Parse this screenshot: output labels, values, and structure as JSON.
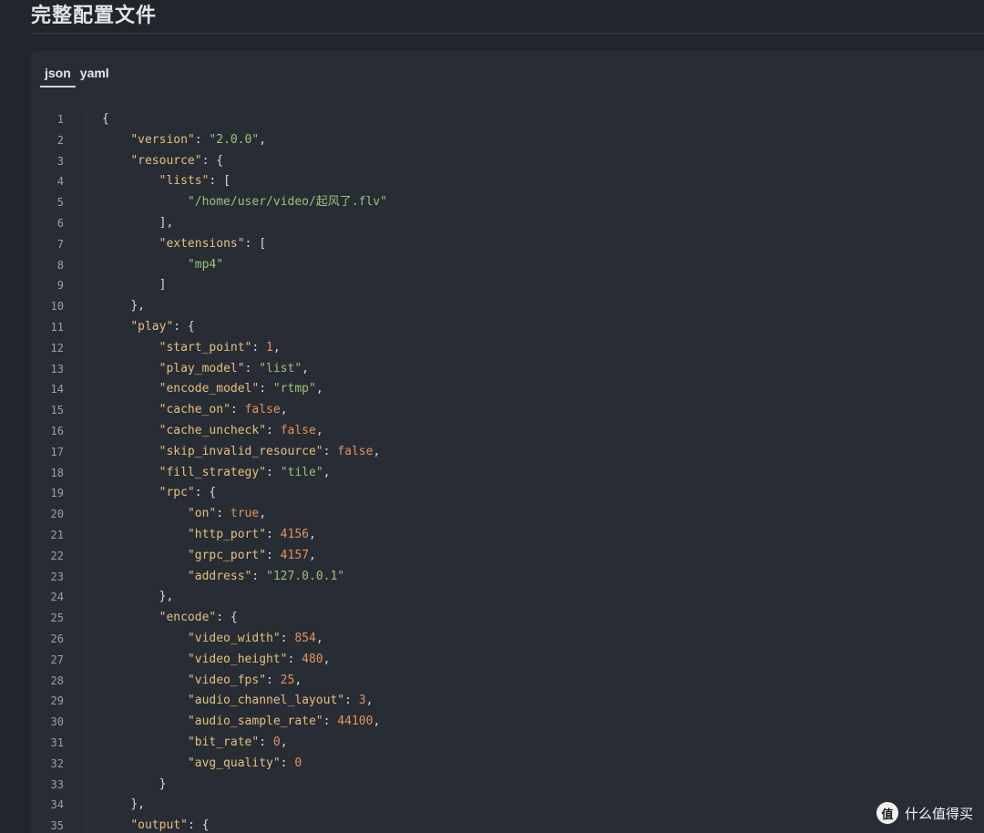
{
  "page": {
    "title": "完整配置文件"
  },
  "tabs": [
    {
      "label": "json",
      "active": true
    },
    {
      "label": "yaml",
      "active": false
    }
  ],
  "code": {
    "language": "json",
    "lines": [
      [
        {
          "t": "p",
          "v": "{"
        }
      ],
      [
        {
          "t": "i",
          "v": "    "
        },
        {
          "t": "k",
          "v": "\"version\""
        },
        {
          "t": "p",
          "v": ": "
        },
        {
          "t": "s",
          "v": "\"2.0.0\""
        },
        {
          "t": "p",
          "v": ","
        }
      ],
      [
        {
          "t": "i",
          "v": "    "
        },
        {
          "t": "k",
          "v": "\"resource\""
        },
        {
          "t": "p",
          "v": ": {"
        }
      ],
      [
        {
          "t": "i",
          "v": "        "
        },
        {
          "t": "k",
          "v": "\"lists\""
        },
        {
          "t": "p",
          "v": ": ["
        }
      ],
      [
        {
          "t": "i",
          "v": "            "
        },
        {
          "t": "s",
          "v": "\"/home/user/video/起风了.flv\""
        }
      ],
      [
        {
          "t": "i",
          "v": "        "
        },
        {
          "t": "p",
          "v": "],"
        }
      ],
      [
        {
          "t": "i",
          "v": "        "
        },
        {
          "t": "k",
          "v": "\"extensions\""
        },
        {
          "t": "p",
          "v": ": ["
        }
      ],
      [
        {
          "t": "i",
          "v": "            "
        },
        {
          "t": "s",
          "v": "\"mp4\""
        }
      ],
      [
        {
          "t": "i",
          "v": "        "
        },
        {
          "t": "p",
          "v": "]"
        }
      ],
      [
        {
          "t": "i",
          "v": "    "
        },
        {
          "t": "p",
          "v": "},"
        }
      ],
      [
        {
          "t": "i",
          "v": "    "
        },
        {
          "t": "k",
          "v": "\"play\""
        },
        {
          "t": "p",
          "v": ": {"
        }
      ],
      [
        {
          "t": "i",
          "v": "        "
        },
        {
          "t": "k",
          "v": "\"start_point\""
        },
        {
          "t": "p",
          "v": ": "
        },
        {
          "t": "n",
          "v": "1"
        },
        {
          "t": "p",
          "v": ","
        }
      ],
      [
        {
          "t": "i",
          "v": "        "
        },
        {
          "t": "k",
          "v": "\"play_model\""
        },
        {
          "t": "p",
          "v": ": "
        },
        {
          "t": "s",
          "v": "\"list\""
        },
        {
          "t": "p",
          "v": ","
        }
      ],
      [
        {
          "t": "i",
          "v": "        "
        },
        {
          "t": "k",
          "v": "\"encode_model\""
        },
        {
          "t": "p",
          "v": ": "
        },
        {
          "t": "s",
          "v": "\"rtmp\""
        },
        {
          "t": "p",
          "v": ","
        }
      ],
      [
        {
          "t": "i",
          "v": "        "
        },
        {
          "t": "k",
          "v": "\"cache_on\""
        },
        {
          "t": "p",
          "v": ": "
        },
        {
          "t": "b",
          "v": "false"
        },
        {
          "t": "p",
          "v": ","
        }
      ],
      [
        {
          "t": "i",
          "v": "        "
        },
        {
          "t": "k",
          "v": "\"cache_uncheck\""
        },
        {
          "t": "p",
          "v": ": "
        },
        {
          "t": "b",
          "v": "false"
        },
        {
          "t": "p",
          "v": ","
        }
      ],
      [
        {
          "t": "i",
          "v": "        "
        },
        {
          "t": "k",
          "v": "\"skip_invalid_resource\""
        },
        {
          "t": "p",
          "v": ": "
        },
        {
          "t": "b",
          "v": "false"
        },
        {
          "t": "p",
          "v": ","
        }
      ],
      [
        {
          "t": "i",
          "v": "        "
        },
        {
          "t": "k",
          "v": "\"fill_strategy\""
        },
        {
          "t": "p",
          "v": ": "
        },
        {
          "t": "s",
          "v": "\"tile\""
        },
        {
          "t": "p",
          "v": ","
        }
      ],
      [
        {
          "t": "i",
          "v": "        "
        },
        {
          "t": "k",
          "v": "\"rpc\""
        },
        {
          "t": "p",
          "v": ": {"
        }
      ],
      [
        {
          "t": "i",
          "v": "            "
        },
        {
          "t": "k",
          "v": "\"on\""
        },
        {
          "t": "p",
          "v": ": "
        },
        {
          "t": "b",
          "v": "true"
        },
        {
          "t": "p",
          "v": ","
        }
      ],
      [
        {
          "t": "i",
          "v": "            "
        },
        {
          "t": "k",
          "v": "\"http_port\""
        },
        {
          "t": "p",
          "v": ": "
        },
        {
          "t": "n",
          "v": "4156"
        },
        {
          "t": "p",
          "v": ","
        }
      ],
      [
        {
          "t": "i",
          "v": "            "
        },
        {
          "t": "k",
          "v": "\"grpc_port\""
        },
        {
          "t": "p",
          "v": ": "
        },
        {
          "t": "n",
          "v": "4157"
        },
        {
          "t": "p",
          "v": ","
        }
      ],
      [
        {
          "t": "i",
          "v": "            "
        },
        {
          "t": "k",
          "v": "\"address\""
        },
        {
          "t": "p",
          "v": ": "
        },
        {
          "t": "s",
          "v": "\"127.0.0.1\""
        }
      ],
      [
        {
          "t": "i",
          "v": "        "
        },
        {
          "t": "p",
          "v": "},"
        }
      ],
      [
        {
          "t": "i",
          "v": "        "
        },
        {
          "t": "k",
          "v": "\"encode\""
        },
        {
          "t": "p",
          "v": ": {"
        }
      ],
      [
        {
          "t": "i",
          "v": "            "
        },
        {
          "t": "k",
          "v": "\"video_width\""
        },
        {
          "t": "p",
          "v": ": "
        },
        {
          "t": "n",
          "v": "854"
        },
        {
          "t": "p",
          "v": ","
        }
      ],
      [
        {
          "t": "i",
          "v": "            "
        },
        {
          "t": "k",
          "v": "\"video_height\""
        },
        {
          "t": "p",
          "v": ": "
        },
        {
          "t": "n",
          "v": "480"
        },
        {
          "t": "p",
          "v": ","
        }
      ],
      [
        {
          "t": "i",
          "v": "            "
        },
        {
          "t": "k",
          "v": "\"video_fps\""
        },
        {
          "t": "p",
          "v": ": "
        },
        {
          "t": "n",
          "v": "25"
        },
        {
          "t": "p",
          "v": ","
        }
      ],
      [
        {
          "t": "i",
          "v": "            "
        },
        {
          "t": "k",
          "v": "\"audio_channel_layout\""
        },
        {
          "t": "p",
          "v": ": "
        },
        {
          "t": "n",
          "v": "3"
        },
        {
          "t": "p",
          "v": ","
        }
      ],
      [
        {
          "t": "i",
          "v": "            "
        },
        {
          "t": "k",
          "v": "\"audio_sample_rate\""
        },
        {
          "t": "p",
          "v": ": "
        },
        {
          "t": "n",
          "v": "44100"
        },
        {
          "t": "p",
          "v": ","
        }
      ],
      [
        {
          "t": "i",
          "v": "            "
        },
        {
          "t": "k",
          "v": "\"bit_rate\""
        },
        {
          "t": "p",
          "v": ": "
        },
        {
          "t": "n",
          "v": "0"
        },
        {
          "t": "p",
          "v": ","
        }
      ],
      [
        {
          "t": "i",
          "v": "            "
        },
        {
          "t": "k",
          "v": "\"avg_quality\""
        },
        {
          "t": "p",
          "v": ": "
        },
        {
          "t": "n",
          "v": "0"
        }
      ],
      [
        {
          "t": "i",
          "v": "        "
        },
        {
          "t": "p",
          "v": "}"
        }
      ],
      [
        {
          "t": "i",
          "v": "    "
        },
        {
          "t": "p",
          "v": "},"
        }
      ],
      [
        {
          "t": "i",
          "v": "    "
        },
        {
          "t": "k",
          "v": "\"output\""
        },
        {
          "t": "p",
          "v": ": {"
        }
      ]
    ]
  },
  "watermark": {
    "logo_glyph": "值",
    "text": "什么值得买"
  },
  "colors": {
    "background": "#22252b",
    "panel": "#282c34",
    "key": "#e5c07b",
    "string": "#98c379",
    "number": "#e5935a",
    "line_number": "#9aa0aa"
  }
}
